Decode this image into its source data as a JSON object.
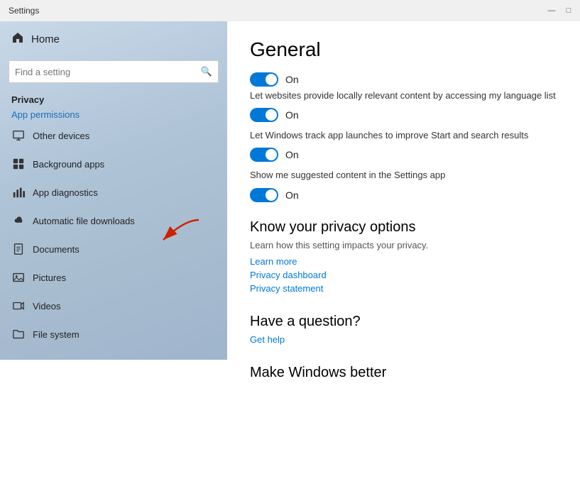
{
  "titleBar": {
    "title": "Settings",
    "minimize": "—",
    "maximize": "□"
  },
  "sidebar": {
    "home_label": "Home",
    "search_placeholder": "Find a setting",
    "privacy_label": "Privacy",
    "app_permissions_label": "App permissions",
    "items": [
      {
        "id": "other-devices",
        "label": "Other devices",
        "icon": "monitor"
      },
      {
        "id": "background-apps",
        "label": "Background apps",
        "icon": "grid"
      },
      {
        "id": "app-diagnostics",
        "label": "App diagnostics",
        "icon": "chart"
      },
      {
        "id": "automatic-file-downloads",
        "label": "Automatic file downloads",
        "icon": "cloud"
      },
      {
        "id": "documents",
        "label": "Documents",
        "icon": "doc"
      },
      {
        "id": "pictures",
        "label": "Pictures",
        "icon": "photo"
      },
      {
        "id": "videos",
        "label": "Videos",
        "icon": "video"
      },
      {
        "id": "file-system",
        "label": "File system",
        "icon": "folder"
      }
    ]
  },
  "content": {
    "title": "General",
    "settings": [
      {
        "id": "language-list",
        "toggle": true,
        "toggle_label": "On",
        "description": "Let websites provide locally relevant content by accessing my language list"
      },
      {
        "id": "app-launches",
        "toggle": true,
        "toggle_label": "On",
        "description": "Let Windows track app launches to improve Start and search results"
      },
      {
        "id": "suggested-content",
        "toggle": true,
        "toggle_label": "On",
        "description": "Show me suggested content in the Settings app"
      }
    ],
    "privacy_section": {
      "title": "Know your privacy options",
      "subtitle": "Learn how this setting impacts your privacy.",
      "links": [
        "Learn more",
        "Privacy dashboard",
        "Privacy statement"
      ]
    },
    "question_section": {
      "title": "Have a question?",
      "link": "Get help"
    },
    "make_windows": {
      "title": "Make Windows better"
    }
  }
}
